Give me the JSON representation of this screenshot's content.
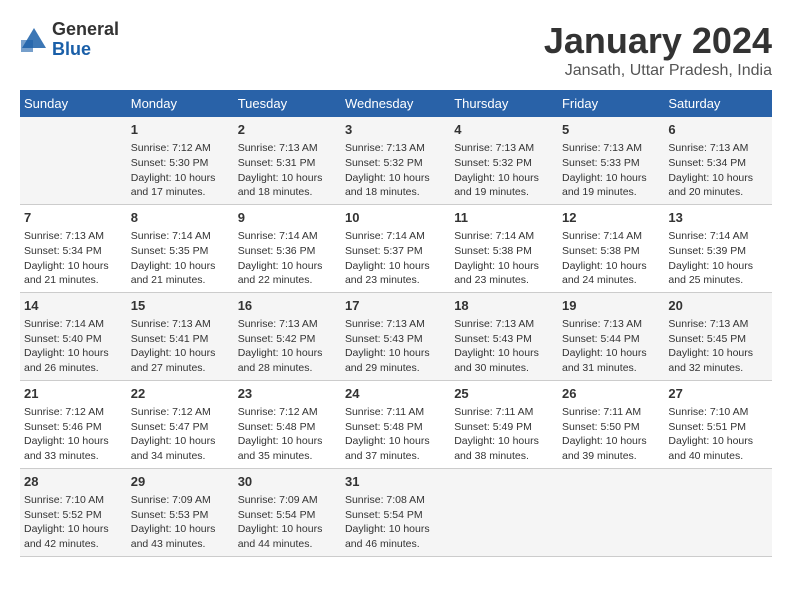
{
  "header": {
    "logo_general": "General",
    "logo_blue": "Blue",
    "month": "January 2024",
    "location": "Jansath, Uttar Pradesh, India"
  },
  "weekdays": [
    "Sunday",
    "Monday",
    "Tuesday",
    "Wednesday",
    "Thursday",
    "Friday",
    "Saturday"
  ],
  "weeks": [
    [
      {
        "day": "",
        "sunrise": "",
        "sunset": "",
        "daylight": ""
      },
      {
        "day": "1",
        "sunrise": "Sunrise: 7:12 AM",
        "sunset": "Sunset: 5:30 PM",
        "daylight": "Daylight: 10 hours and 17 minutes."
      },
      {
        "day": "2",
        "sunrise": "Sunrise: 7:13 AM",
        "sunset": "Sunset: 5:31 PM",
        "daylight": "Daylight: 10 hours and 18 minutes."
      },
      {
        "day": "3",
        "sunrise": "Sunrise: 7:13 AM",
        "sunset": "Sunset: 5:32 PM",
        "daylight": "Daylight: 10 hours and 18 minutes."
      },
      {
        "day": "4",
        "sunrise": "Sunrise: 7:13 AM",
        "sunset": "Sunset: 5:32 PM",
        "daylight": "Daylight: 10 hours and 19 minutes."
      },
      {
        "day": "5",
        "sunrise": "Sunrise: 7:13 AM",
        "sunset": "Sunset: 5:33 PM",
        "daylight": "Daylight: 10 hours and 19 minutes."
      },
      {
        "day": "6",
        "sunrise": "Sunrise: 7:13 AM",
        "sunset": "Sunset: 5:34 PM",
        "daylight": "Daylight: 10 hours and 20 minutes."
      }
    ],
    [
      {
        "day": "7",
        "sunrise": "Sunrise: 7:13 AM",
        "sunset": "Sunset: 5:34 PM",
        "daylight": "Daylight: 10 hours and 21 minutes."
      },
      {
        "day": "8",
        "sunrise": "Sunrise: 7:14 AM",
        "sunset": "Sunset: 5:35 PM",
        "daylight": "Daylight: 10 hours and 21 minutes."
      },
      {
        "day": "9",
        "sunrise": "Sunrise: 7:14 AM",
        "sunset": "Sunset: 5:36 PM",
        "daylight": "Daylight: 10 hours and 22 minutes."
      },
      {
        "day": "10",
        "sunrise": "Sunrise: 7:14 AM",
        "sunset": "Sunset: 5:37 PM",
        "daylight": "Daylight: 10 hours and 23 minutes."
      },
      {
        "day": "11",
        "sunrise": "Sunrise: 7:14 AM",
        "sunset": "Sunset: 5:38 PM",
        "daylight": "Daylight: 10 hours and 23 minutes."
      },
      {
        "day": "12",
        "sunrise": "Sunrise: 7:14 AM",
        "sunset": "Sunset: 5:38 PM",
        "daylight": "Daylight: 10 hours and 24 minutes."
      },
      {
        "day": "13",
        "sunrise": "Sunrise: 7:14 AM",
        "sunset": "Sunset: 5:39 PM",
        "daylight": "Daylight: 10 hours and 25 minutes."
      }
    ],
    [
      {
        "day": "14",
        "sunrise": "Sunrise: 7:14 AM",
        "sunset": "Sunset: 5:40 PM",
        "daylight": "Daylight: 10 hours and 26 minutes."
      },
      {
        "day": "15",
        "sunrise": "Sunrise: 7:13 AM",
        "sunset": "Sunset: 5:41 PM",
        "daylight": "Daylight: 10 hours and 27 minutes."
      },
      {
        "day": "16",
        "sunrise": "Sunrise: 7:13 AM",
        "sunset": "Sunset: 5:42 PM",
        "daylight": "Daylight: 10 hours and 28 minutes."
      },
      {
        "day": "17",
        "sunrise": "Sunrise: 7:13 AM",
        "sunset": "Sunset: 5:43 PM",
        "daylight": "Daylight: 10 hours and 29 minutes."
      },
      {
        "day": "18",
        "sunrise": "Sunrise: 7:13 AM",
        "sunset": "Sunset: 5:43 PM",
        "daylight": "Daylight: 10 hours and 30 minutes."
      },
      {
        "day": "19",
        "sunrise": "Sunrise: 7:13 AM",
        "sunset": "Sunset: 5:44 PM",
        "daylight": "Daylight: 10 hours and 31 minutes."
      },
      {
        "day": "20",
        "sunrise": "Sunrise: 7:13 AM",
        "sunset": "Sunset: 5:45 PM",
        "daylight": "Daylight: 10 hours and 32 minutes."
      }
    ],
    [
      {
        "day": "21",
        "sunrise": "Sunrise: 7:12 AM",
        "sunset": "Sunset: 5:46 PM",
        "daylight": "Daylight: 10 hours and 33 minutes."
      },
      {
        "day": "22",
        "sunrise": "Sunrise: 7:12 AM",
        "sunset": "Sunset: 5:47 PM",
        "daylight": "Daylight: 10 hours and 34 minutes."
      },
      {
        "day": "23",
        "sunrise": "Sunrise: 7:12 AM",
        "sunset": "Sunset: 5:48 PM",
        "daylight": "Daylight: 10 hours and 35 minutes."
      },
      {
        "day": "24",
        "sunrise": "Sunrise: 7:11 AM",
        "sunset": "Sunset: 5:48 PM",
        "daylight": "Daylight: 10 hours and 37 minutes."
      },
      {
        "day": "25",
        "sunrise": "Sunrise: 7:11 AM",
        "sunset": "Sunset: 5:49 PM",
        "daylight": "Daylight: 10 hours and 38 minutes."
      },
      {
        "day": "26",
        "sunrise": "Sunrise: 7:11 AM",
        "sunset": "Sunset: 5:50 PM",
        "daylight": "Daylight: 10 hours and 39 minutes."
      },
      {
        "day": "27",
        "sunrise": "Sunrise: 7:10 AM",
        "sunset": "Sunset: 5:51 PM",
        "daylight": "Daylight: 10 hours and 40 minutes."
      }
    ],
    [
      {
        "day": "28",
        "sunrise": "Sunrise: 7:10 AM",
        "sunset": "Sunset: 5:52 PM",
        "daylight": "Daylight: 10 hours and 42 minutes."
      },
      {
        "day": "29",
        "sunrise": "Sunrise: 7:09 AM",
        "sunset": "Sunset: 5:53 PM",
        "daylight": "Daylight: 10 hours and 43 minutes."
      },
      {
        "day": "30",
        "sunrise": "Sunrise: 7:09 AM",
        "sunset": "Sunset: 5:54 PM",
        "daylight": "Daylight: 10 hours and 44 minutes."
      },
      {
        "day": "31",
        "sunrise": "Sunrise: 7:08 AM",
        "sunset": "Sunset: 5:54 PM",
        "daylight": "Daylight: 10 hours and 46 minutes."
      },
      {
        "day": "",
        "sunrise": "",
        "sunset": "",
        "daylight": ""
      },
      {
        "day": "",
        "sunrise": "",
        "sunset": "",
        "daylight": ""
      },
      {
        "day": "",
        "sunrise": "",
        "sunset": "",
        "daylight": ""
      }
    ]
  ]
}
